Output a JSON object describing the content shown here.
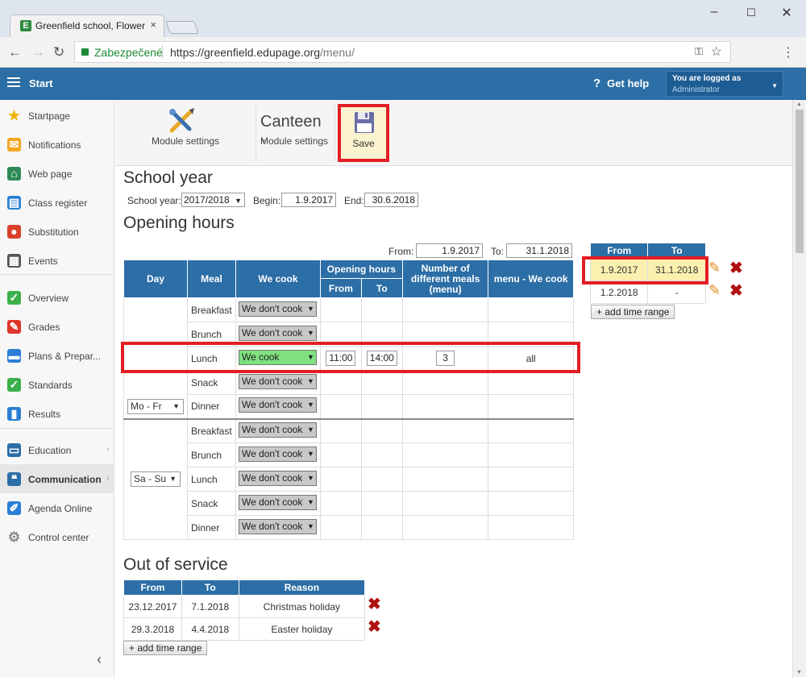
{
  "browser": {
    "tab_title": "Greenfield school, Flower",
    "tab_close": "×",
    "security_label": "Zabezpečené",
    "url_host": "https://greenfield.edupage.org",
    "url_path": "/menu/"
  },
  "appbar": {
    "start_label": "Start",
    "help_label": "Get help",
    "logged_label": "You are logged as",
    "user_name": "Administrator"
  },
  "sidebar": {
    "items": [
      {
        "label": "Startpage",
        "icon": "star-icon",
        "color": "#f0b400"
      },
      {
        "label": "Notifications",
        "icon": "envelope-icon",
        "color": "#f5a623"
      },
      {
        "label": "Web page",
        "icon": "home-icon",
        "color": "#2e8b57"
      },
      {
        "label": "Class register",
        "icon": "book-icon",
        "color": "#2a7fd4"
      },
      {
        "label": "Substitution",
        "icon": "person-icon",
        "color": "#d9412b"
      },
      {
        "label": "Events",
        "icon": "calendar-icon",
        "color": "#555555"
      },
      {
        "label": "Overview",
        "icon": "check-circle-icon",
        "color": "#3cb04a"
      },
      {
        "label": "Grades",
        "icon": "grades-icon",
        "color": "#e0352b"
      },
      {
        "label": "Plans & Prepar...",
        "icon": "briefcase-icon",
        "color": "#2a7fd4"
      },
      {
        "label": "Standards",
        "icon": "shield-check-icon",
        "color": "#3cb04a"
      },
      {
        "label": "Results",
        "icon": "bar-chart-icon",
        "color": "#2a7fd4"
      },
      {
        "label": "Education",
        "icon": "education-icon",
        "color": "#2a6ea6"
      },
      {
        "label": "Communication",
        "icon": "chat-icon",
        "color": "#2c6ea6"
      },
      {
        "label": "Agenda Online",
        "icon": "pen-icon",
        "color": "#2a7fd4"
      },
      {
        "label": "Control center",
        "icon": "gear-icon",
        "color": "#888888"
      }
    ]
  },
  "toolbar": {
    "module_settings_label": "Module settings",
    "canteen_title": "Canteen",
    "canteen_sub": "Module settings",
    "save_label": "Save"
  },
  "school_year": {
    "heading": "School year",
    "year_label": "School year:",
    "year_value": "2017/2018",
    "begin_label": "Begin:",
    "begin_value": "1.9.2017",
    "end_label": "End:",
    "end_value": "30.6.2018"
  },
  "opening": {
    "heading": "Opening hours",
    "from_label": "From:",
    "from_value": "1.9.2017",
    "to_label": "To:",
    "to_value": "31.1.2018",
    "headers": {
      "day": "Day",
      "meal": "Meal",
      "we_cook": "We cook",
      "opening_hours": "Opening hours",
      "from": "From",
      "to": "To",
      "num_meals": "Number of different meals (menu)",
      "menu_we_cook": "menu - We cook"
    },
    "groups": [
      {
        "day": "Mo - Fr",
        "rows": [
          {
            "meal": "Breakfast",
            "cook": "We don't cook",
            "from": "",
            "to": "",
            "num": "",
            "menu": ""
          },
          {
            "meal": "Brunch",
            "cook": "We don't cook",
            "from": "",
            "to": "",
            "num": "",
            "menu": ""
          },
          {
            "meal": "Lunch",
            "cook": "We cook",
            "from": "11:00",
            "to": "14:00",
            "num": "3",
            "menu": "all"
          },
          {
            "meal": "Snack",
            "cook": "We don't cook",
            "from": "",
            "to": "",
            "num": "",
            "menu": ""
          },
          {
            "meal": "Dinner",
            "cook": "We don't cook",
            "from": "",
            "to": "",
            "num": "",
            "menu": ""
          }
        ]
      },
      {
        "day": "Sa - Su",
        "rows": [
          {
            "meal": "Breakfast",
            "cook": "We don't cook",
            "from": "",
            "to": "",
            "num": "",
            "menu": ""
          },
          {
            "meal": "Brunch",
            "cook": "We don't cook",
            "from": "",
            "to": "",
            "num": "",
            "menu": ""
          },
          {
            "meal": "Lunch",
            "cook": "We don't cook",
            "from": "",
            "to": "",
            "num": "",
            "menu": ""
          },
          {
            "meal": "Snack",
            "cook": "We don't cook",
            "from": "",
            "to": "",
            "num": "",
            "menu": ""
          },
          {
            "meal": "Dinner",
            "cook": "We don't cook",
            "from": "",
            "to": "",
            "num": "",
            "menu": ""
          }
        ]
      }
    ]
  },
  "ranges": {
    "from_header": "From",
    "to_header": "To",
    "rows": [
      {
        "from": "1.9.2017",
        "to": "31.1.2018"
      },
      {
        "from": "1.2.2018",
        "to": "-"
      }
    ],
    "add_label": "+ add time range"
  },
  "out_of_service": {
    "heading": "Out of service",
    "headers": {
      "from": "From",
      "to": "To",
      "reason": "Reason"
    },
    "rows": [
      {
        "from": "23.12.2017",
        "to": "7.1.2018",
        "reason": "Christmas holiday"
      },
      {
        "from": "29.3.2018",
        "to": "4.4.2018",
        "reason": "Easter holiday"
      }
    ],
    "add_label": "+ add time range"
  },
  "colors": {
    "brand_blue": "#2c6ea6",
    "highlight_red": "#e31e24",
    "we_cook_green": "#7ee07e",
    "selected_row_yellow": "#fbf0b0"
  }
}
